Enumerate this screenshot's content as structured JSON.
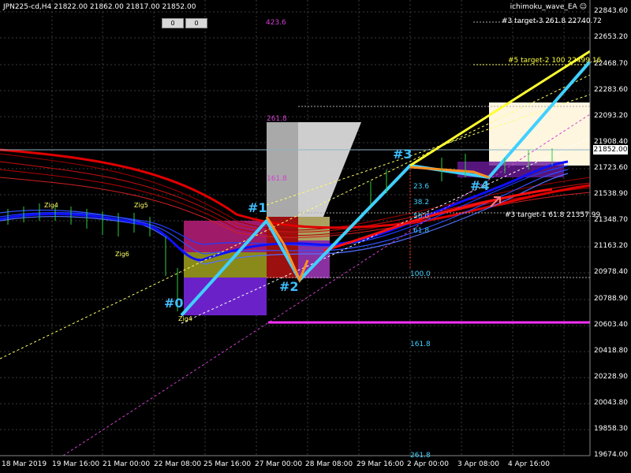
{
  "window": {
    "title": "JPN225-cd,H4  21822.00 21862.00 21817.00 21852.00",
    "ea_name": "ichimoku_wave_EA",
    "ea_icon": "smiley-icon",
    "buttons": [
      "0",
      "0"
    ]
  },
  "price_axis": {
    "labels": [
      "22843.60",
      "22653.20",
      "22468.70",
      "22283.60",
      "22093.20",
      "21908.40",
      "21723.60",
      "21538.90",
      "21348.70",
      "21163.20",
      "20978.40",
      "20788.90",
      "20603.40",
      "20418.80",
      "20228.90",
      "20043.80",
      "19858.30",
      "19674.00"
    ],
    "current_price": "21852.00"
  },
  "time_axis": {
    "labels": [
      "18 Mar 2019",
      "19 Mar 16:00",
      "21 Mar 00:00",
      "22 Mar 08:00",
      "25 Mar 16:00",
      "27 Mar 00:00",
      "28 Mar 08:00",
      "29 Mar 16:00",
      "2 Apr 00:00",
      "3 Apr 08:00",
      "4 Apr 16:00"
    ]
  },
  "annotations": {
    "target3_top": "#3 target-3 261.8 22740.72",
    "target5": "#5 target-2 100 22499.16",
    "target1": "#3 target-1 61.8 21357.99",
    "fib_423": "423.6",
    "fib_261": "261.8",
    "fib_161_top": "161.8",
    "fib_100": "100.0",
    "fib_161_bottom": "161.8",
    "fib_261_bottom": "261.8",
    "fib_236": "23.6",
    "fib_382": "38.2",
    "fib_500": "50.0",
    "fib_618": "61.8"
  },
  "waves": [
    "#0",
    "#1",
    "#2",
    "#3",
    "#4"
  ],
  "zigzag": [
    "Zig4",
    "Zig5",
    "Zig6",
    "Zig4"
  ]
}
